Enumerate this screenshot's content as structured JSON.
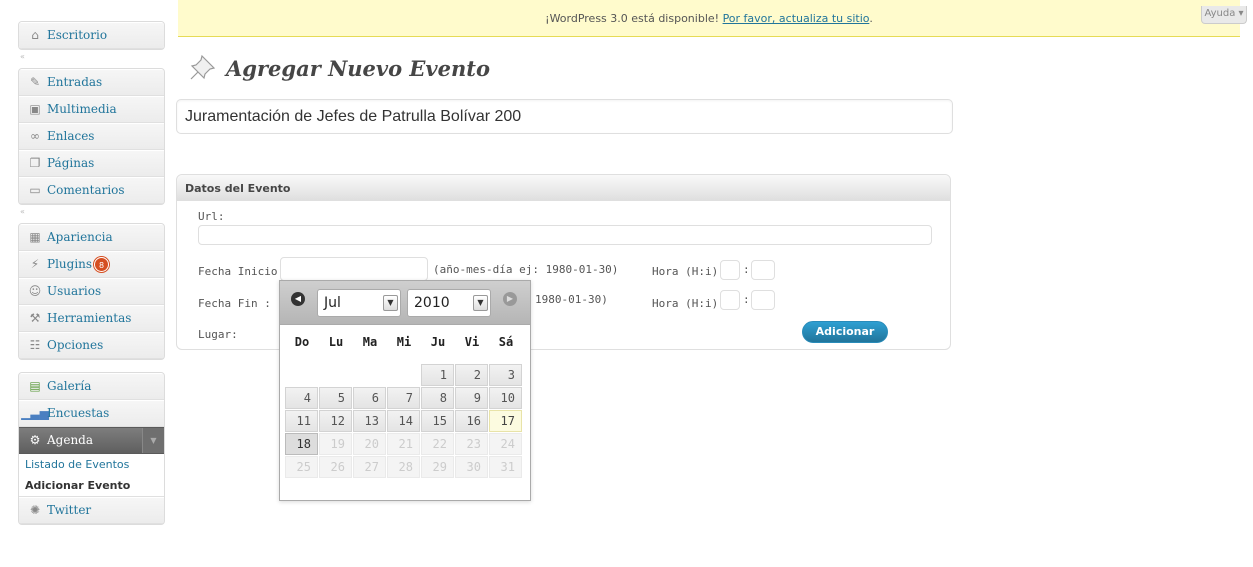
{
  "menu": {
    "dashboard": "Escritorio",
    "group1": [
      {
        "label": "Entradas",
        "icon": "pin-icon"
      },
      {
        "label": "Multimedia",
        "icon": "media-icon"
      },
      {
        "label": "Enlaces",
        "icon": "link-icon"
      },
      {
        "label": "Páginas",
        "icon": "pages-icon"
      },
      {
        "label": "Comentarios",
        "icon": "comments-icon"
      }
    ],
    "group2": [
      {
        "label": "Apariencia",
        "icon": "appearance-icon"
      },
      {
        "label": "Plugins",
        "icon": "plugins-icon",
        "badge": "8"
      },
      {
        "label": "Usuarios",
        "icon": "users-icon"
      },
      {
        "label": "Herramientas",
        "icon": "tools-icon"
      },
      {
        "label": "Opciones",
        "icon": "settings-icon"
      }
    ],
    "group3": [
      {
        "label": "Galería",
        "icon": "gallery-icon"
      },
      {
        "label": "Encuestas",
        "icon": "polls-icon"
      }
    ],
    "agenda": "Agenda",
    "submenu": [
      "Listado de Eventos",
      "Adicionar Evento"
    ],
    "twitter": "Twitter"
  },
  "notice": {
    "text": "¡WordPress 3.0 está disponible! ",
    "link": "Por favor, actualiza tu sitio",
    "end": "."
  },
  "help": "Ayuda ▾",
  "page_title": "Agregar Nuevo Evento",
  "title_value": "Juramentación de Jefes de Patrulla Bolívar 200",
  "postbox": {
    "title": "Datos del Evento",
    "url_label": "Url:",
    "start_label": "Fecha Inicio :",
    "end_label": "Fecha Fin :",
    "place_label": "Lugar:",
    "date_hint": "(año-mes-día ej: 1980-01-30)",
    "date_hint_partial": "1980-01-30)",
    "hour_label": "Hora (H:i):",
    "colon": ":",
    "submit": "Adicionar"
  },
  "datepicker": {
    "month": "Jul",
    "year": "2010",
    "weekdays": [
      "Do",
      "Lu",
      "Ma",
      "Mi",
      "Ju",
      "Vi",
      "Sá"
    ],
    "weeks": [
      [
        "",
        "",
        "",
        "",
        "1",
        "2",
        "3"
      ],
      [
        "4",
        "5",
        "6",
        "7",
        "8",
        "9",
        "10"
      ],
      [
        "11",
        "12",
        "13",
        "14",
        "15",
        "16",
        "17"
      ],
      [
        "18",
        "19",
        "20",
        "21",
        "22",
        "23",
        "24"
      ],
      [
        "25",
        "26",
        "27",
        "28",
        "29",
        "30",
        "31"
      ]
    ],
    "today": "17",
    "selected": "18",
    "max_enabled": 18
  }
}
